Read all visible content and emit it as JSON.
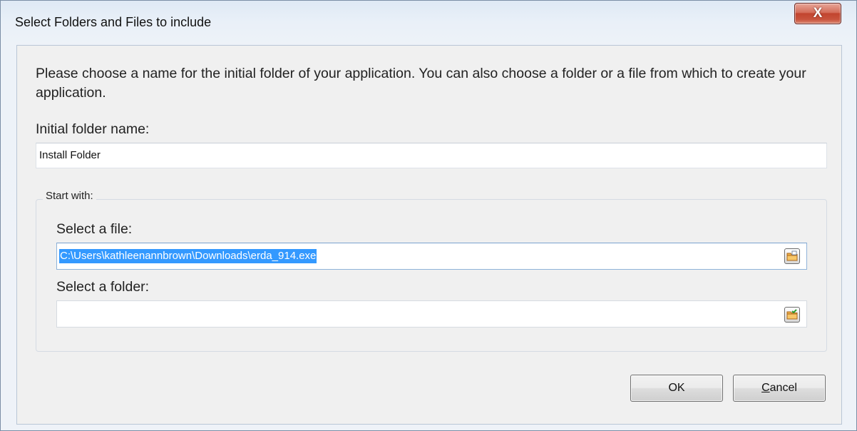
{
  "window": {
    "title": "Select Folders and Files to include",
    "close_label": "X"
  },
  "intro_text": "Please choose a name for the initial folder of your application. You can also choose a folder or a file from which to create your application.",
  "initial_folder": {
    "label": "Initial folder name:",
    "value": "Install Folder"
  },
  "start_with": {
    "group_label": "Start with:",
    "file": {
      "label": "Select a file:",
      "value": "C:\\Users\\kathleenannbrown\\Downloads\\erda_914.exe",
      "browse_icon": "browse-file-icon"
    },
    "folder": {
      "label": "Select a folder:",
      "value": "",
      "browse_icon": "browse-folder-icon"
    }
  },
  "buttons": {
    "ok_label": "OK",
    "cancel_first": "C",
    "cancel_rest": "ancel"
  }
}
